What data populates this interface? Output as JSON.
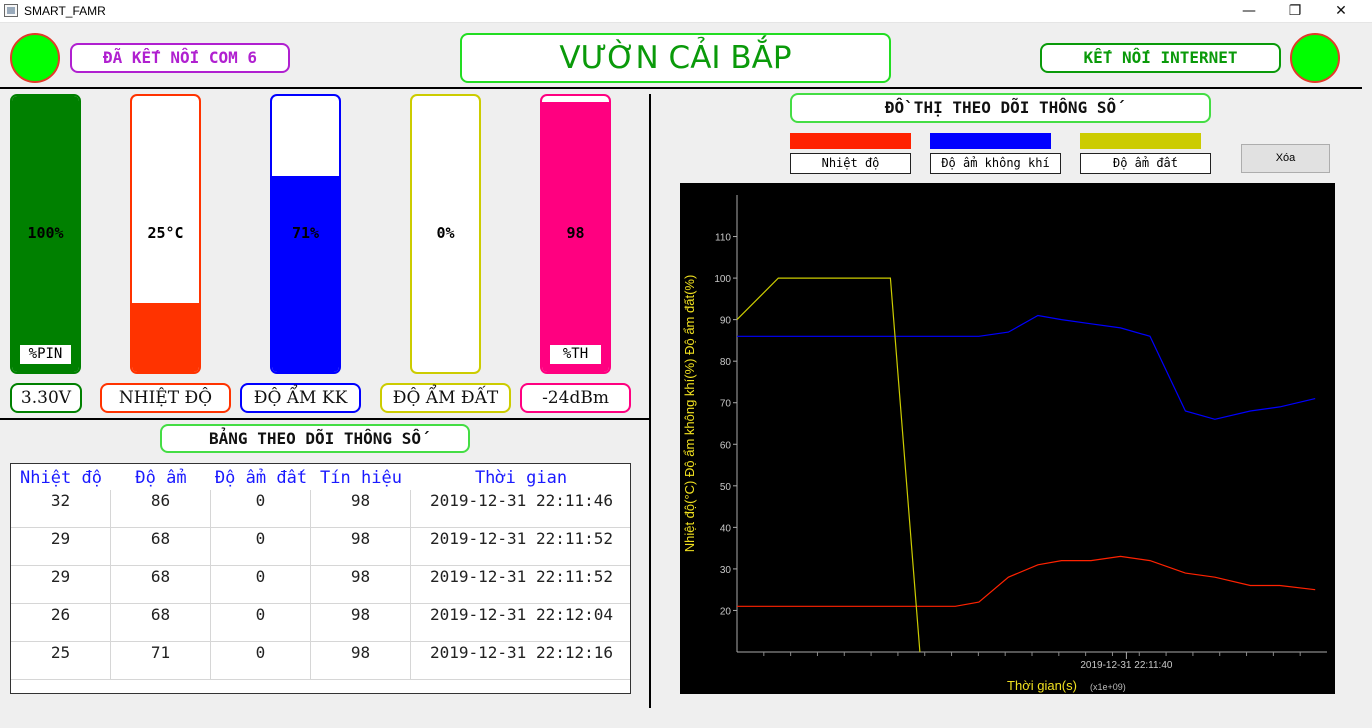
{
  "window": {
    "title": "SMART_FAMR"
  },
  "header": {
    "com_status": "ĐÃ KẾT NỐI COM 6",
    "app_title": "VƯỜN CẢI BẮP",
    "internet_status": "KẾT NỐI INTERNET",
    "led_color": "#00ff00"
  },
  "gauges": [
    {
      "value_text": "100%",
      "tag": "%PIN",
      "label": "3.30V",
      "level": 1.0,
      "color": "#008000",
      "border": "#008000"
    },
    {
      "value_text": "25°C",
      "tag": "",
      "label": "NHIỆT ĐỘ",
      "level": 0.25,
      "color": "#ff3300",
      "border": "#ff3300"
    },
    {
      "value_text": "71%",
      "tag": "",
      "label": "ĐỘ ẨM KK",
      "level": 0.71,
      "color": "#0000ff",
      "border": "#0000ff"
    },
    {
      "value_text": "0%",
      "tag": "",
      "label": "ĐỘ ẨM ĐẤT",
      "level": 0.0,
      "color": "#cccc00",
      "border": "#cccc00"
    },
    {
      "value_text": "98",
      "tag": "%TH",
      "label": "-24dBm",
      "level": 0.98,
      "color": "#ff0080",
      "border": "#ff0080"
    }
  ],
  "table": {
    "title": "BẢNG THEO DÕI THÔNG SỐ",
    "columns": [
      "Nhiệt độ",
      "Độ ẩm",
      "Độ ẩm đất",
      "Tín hiệu",
      "Thời gian"
    ],
    "rows": [
      [
        "32",
        "86",
        "0",
        "98",
        "2019-12-31 22:11:46"
      ],
      [
        "29",
        "68",
        "0",
        "98",
        "2019-12-31 22:11:52"
      ],
      [
        "29",
        "68",
        "0",
        "98",
        "2019-12-31 22:11:52"
      ],
      [
        "26",
        "68",
        "0",
        "98",
        "2019-12-31 22:12:04"
      ],
      [
        "25",
        "71",
        "0",
        "98",
        "2019-12-31 22:12:16"
      ]
    ]
  },
  "chart_panel": {
    "title": "ĐỒ THỊ THEO DÕI THÔNG SỐ",
    "legend": [
      {
        "name": "Nhiệt độ",
        "color": "#ff2200"
      },
      {
        "name": "Độ ẩm không khí",
        "color": "#0000ff"
      },
      {
        "name": "Độ ẩm đất",
        "color": "#cccc00"
      }
    ],
    "clear_label": "Xóa"
  },
  "chart_data": {
    "type": "line",
    "xlabel": "Thời gian(s)",
    "xlabel_suffix": "(x1e+09)",
    "ylabel": "Nhiệt độ(°C) Độ ẩm không khí(%) Độ ẩm đất(%)",
    "ylim": [
      10,
      120
    ],
    "yticks": [
      20,
      30,
      40,
      50,
      60,
      70,
      80,
      90,
      100,
      110
    ],
    "xtick_label": "2019-12-31 22:11:40",
    "grid": false,
    "series": [
      {
        "name": "Nhiệt độ",
        "color": "#ff2200",
        "x": [
          0,
          0.37,
          0.41,
          0.46,
          0.51,
          0.55,
          0.6,
          0.65,
          0.7,
          0.76,
          0.81,
          0.87,
          0.92,
          0.98
        ],
        "y": [
          21,
          21,
          22,
          28,
          31,
          32,
          32,
          33,
          32,
          29,
          28,
          26,
          26,
          25
        ]
      },
      {
        "name": "Độ ẩm không khí",
        "color": "#0000ff",
        "x": [
          0,
          0.37,
          0.41,
          0.46,
          0.51,
          0.55,
          0.6,
          0.65,
          0.7,
          0.76,
          0.81,
          0.87,
          0.92,
          0.98
        ],
        "y": [
          86,
          86,
          86,
          87,
          91,
          90,
          89,
          88,
          86,
          68,
          66,
          68,
          69,
          71
        ]
      },
      {
        "name": "Độ ẩm đất",
        "color": "#cccc00",
        "x": [
          0,
          0.07,
          0.26,
          0.31
        ],
        "y": [
          90,
          100,
          100,
          0
        ]
      }
    ]
  }
}
